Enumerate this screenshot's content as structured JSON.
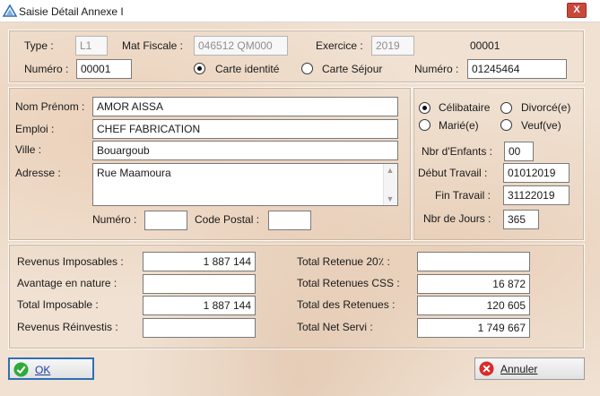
{
  "window": {
    "title": "Saisie Détail Annexe I",
    "close_glyph": "X"
  },
  "header": {
    "type_label": "Type :",
    "type_value": "L1",
    "mat_fiscale_label": "Mat Fiscale :",
    "mat_fiscale_value": "046512 QM000",
    "exercice_label": "Exercice :",
    "exercice_value": "2019",
    "code": "00001",
    "numero_label": "Numéro :",
    "numero_value": "00001",
    "carte_identite_label": "Carte identité",
    "carte_sejour_label": "Carte Séjour",
    "numero2_label": "Numéro :",
    "numero2_value": "01245464"
  },
  "person": {
    "nom_label": "Nom Prénom :",
    "nom_value": "AMOR AISSA",
    "emploi_label": "Emploi :",
    "emploi_value": "CHEF FABRICATION",
    "ville_label": "Ville :",
    "ville_value": "Bouargoub",
    "adresse_label": "Adresse :",
    "adresse_value": "Rue Maamoura",
    "numero_label": "Numéro :",
    "numero_value": "",
    "code_postal_label": "Code Postal :",
    "code_postal_value": ""
  },
  "status": {
    "celibataire_label": "Célibataire",
    "divorce_label": "Divorcé(e)",
    "marie_label": "Marié(e)",
    "veuf_label": "Veuf(ve)",
    "selected": "celibataire",
    "nbr_enfants_label": "Nbr d'Enfants :",
    "nbr_enfants_value": "00",
    "debut_label": "Début Travail :",
    "debut_value": "01012019",
    "fin_label": "Fin Travail :",
    "fin_value": "31122019",
    "nbr_jours_label": "Nbr de Jours :",
    "nbr_jours_value": "365"
  },
  "totals": {
    "revenus_imposables_label": "Revenus Imposables :",
    "revenus_imposables_value": "1 887 144",
    "avantage_label": "Avantage en nature :",
    "avantage_value": "",
    "total_imposable_label": "Total Imposable :",
    "total_imposable_value": "1 887 144",
    "revenus_reinvestis_label": "Revenus Réinvestis :",
    "revenus_reinvestis_value": "",
    "retenue20_label": "Total Retenue 20٪ :",
    "retenue20_value": "",
    "retenues_css_label": "Total Retenues CSS :",
    "retenues_css_value": "16 872",
    "des_retenues_label": "Total des Retenues :",
    "des_retenues_value": "120 605",
    "net_servi_label": "Total Net Servi :",
    "net_servi_value": "1 749 667"
  },
  "buttons": {
    "ok_label": "OK",
    "annuler_label": "Annuler"
  },
  "colors": {
    "ok_icon": "#2eaa3a",
    "cancel_icon": "#d92b2b",
    "ok_border": "#2f6fb5"
  },
  "icons": {
    "app": "app-logo-icon",
    "ok": "check-icon",
    "cancel": "cancel-icon"
  }
}
